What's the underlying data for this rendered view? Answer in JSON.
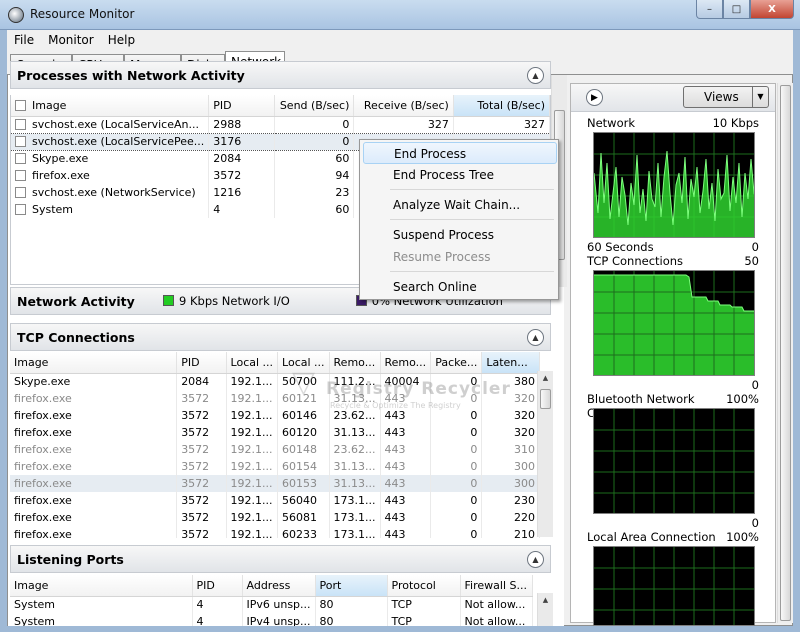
{
  "window": {
    "title": "Resource Monitor",
    "minimize": "–",
    "maximize": "□",
    "close": "X"
  },
  "menu": [
    "File",
    "Monitor",
    "Help"
  ],
  "tabs": [
    "Overview",
    "CPU",
    "Memory",
    "Disk",
    "Network"
  ],
  "processes": {
    "title": "Processes with Network Activity",
    "columns": [
      "Image",
      "PID",
      "Send (B/sec)",
      "Receive (B/sec)",
      "Total (B/sec)"
    ],
    "rows": [
      [
        "svchost.exe (LocalServiceAn...",
        "2988",
        "0",
        "327",
        "327"
      ],
      [
        "svchost.exe (LocalServicePee...",
        "3176",
        "0",
        "",
        ""
      ],
      [
        "Skype.exe",
        "2084",
        "60",
        "",
        ""
      ],
      [
        "firefox.exe",
        "3572",
        "94",
        "",
        ""
      ],
      [
        "svchost.exe (NetworkService)",
        "1216",
        "23",
        "",
        ""
      ],
      [
        "System",
        "4",
        "60",
        "",
        ""
      ]
    ]
  },
  "context_menu": {
    "items": [
      "End Process",
      "End Process Tree",
      "Analyze Wait Chain...",
      "Suspend Process",
      "Resume Process",
      "Search Online"
    ]
  },
  "network_activity": {
    "title": "Network Activity",
    "io_label": "9 Kbps Network I/O",
    "util_label": "0% Network Utilization",
    "io_color": "#22cc22",
    "util_color": "#3a1a66"
  },
  "tcp": {
    "title": "TCP Connections",
    "columns": [
      "Image",
      "PID",
      "Local ...",
      "Local ...",
      "Remo...",
      "Remo...",
      "Packe...",
      "Laten..."
    ],
    "rows": [
      [
        "Skype.exe",
        "2084",
        "192.1...",
        "50700",
        "111.2...",
        "40004",
        "0",
        "380"
      ],
      [
        "firefox.exe",
        "3572",
        "192.1...",
        "60121",
        "31.13...",
        "443",
        "0",
        "320"
      ],
      [
        "firefox.exe",
        "3572",
        "192.1...",
        "60146",
        "23.62...",
        "443",
        "0",
        "320"
      ],
      [
        "firefox.exe",
        "3572",
        "192.1...",
        "60120",
        "31.13...",
        "443",
        "0",
        "320"
      ],
      [
        "firefox.exe",
        "3572",
        "192.1...",
        "60148",
        "23.62...",
        "443",
        "0",
        "310"
      ],
      [
        "firefox.exe",
        "3572",
        "192.1...",
        "60154",
        "31.13...",
        "443",
        "0",
        "300"
      ],
      [
        "firefox.exe",
        "3572",
        "192.1...",
        "60153",
        "31.13...",
        "443",
        "0",
        "300"
      ],
      [
        "firefox.exe",
        "3572",
        "192.1...",
        "56040",
        "173.1...",
        "443",
        "0",
        "230"
      ],
      [
        "firefox.exe",
        "3572",
        "192.1...",
        "56081",
        "173.1...",
        "443",
        "0",
        "220"
      ],
      [
        "firefox.exe",
        "3572",
        "192.1...",
        "60233",
        "173.1...",
        "443",
        "0",
        "210"
      ]
    ]
  },
  "listening": {
    "title": "Listening Ports",
    "columns": [
      "Image",
      "PID",
      "Address",
      "Port",
      "Protocol",
      "Firewall S..."
    ],
    "rows": [
      [
        "System",
        "4",
        "IPv6 unsp...",
        "80",
        "TCP",
        "Not allow..."
      ],
      [
        "System",
        "4",
        "IPv4 unsp...",
        "80",
        "TCP",
        "Not allow..."
      ]
    ]
  },
  "right_pane": {
    "views_label": "Views",
    "graphs": [
      {
        "title": "Network",
        "scale": "10 Kbps",
        "foot_left": "60 Seconds",
        "foot_right": "0"
      },
      {
        "title": "TCP Connections",
        "scale": "50",
        "foot_left": "",
        "foot_right": "0"
      },
      {
        "title": "Bluetooth Network Con...",
        "scale": "100%",
        "foot_left": "",
        "foot_right": "0"
      },
      {
        "title": "Local Area Connection",
        "scale": "100%",
        "foot_left": "",
        "foot_right": ""
      }
    ]
  },
  "watermark": {
    "title": "Registry Recycler",
    "subtitle": "Recycle & Optimize The Registry"
  }
}
